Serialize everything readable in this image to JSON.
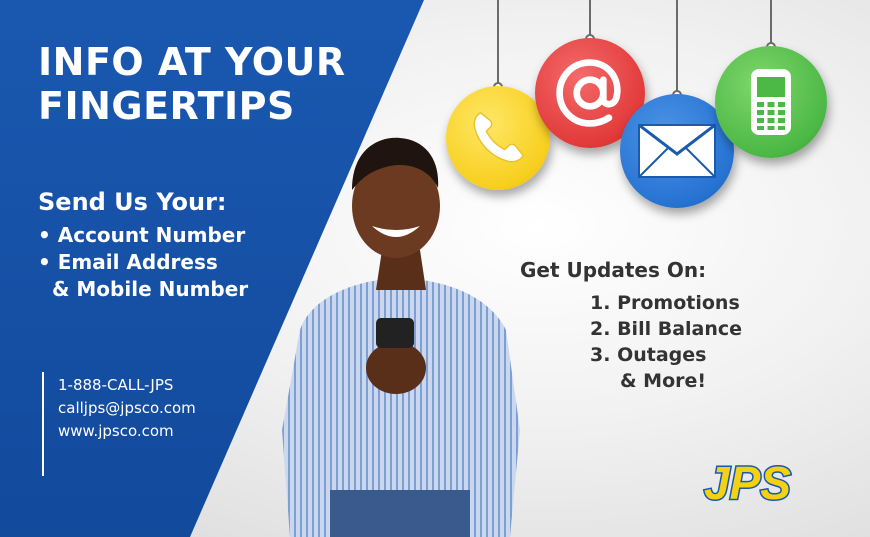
{
  "headline": {
    "line1": "INFO AT YOUR",
    "line2": "FINGERTIPS"
  },
  "send": {
    "title": "Send Us Your:",
    "items": [
      "• Account Number",
      "• Email Address",
      "& Mobile Number"
    ]
  },
  "contact": {
    "phone": "1-888-CALL-JPS",
    "email": "calljps@jpsco.com",
    "website": "www.jpsco.com"
  },
  "updates": {
    "title": "Get  Updates On:",
    "items": [
      {
        "num": "1.",
        "label": "Promotions"
      },
      {
        "num": "2.",
        "label": "Bill Balance"
      },
      {
        "num": "3.",
        "label": "Outages"
      }
    ],
    "more": "& More!"
  },
  "icons": [
    "phone-icon",
    "at-sign-icon",
    "envelope-icon",
    "mobile-phone-icon"
  ],
  "logo": {
    "text": "JPS"
  },
  "colors": {
    "brand_blue": "#1a58b0",
    "logo_yellow": "#f5d20f",
    "logo_blue": "#1a58b0"
  }
}
